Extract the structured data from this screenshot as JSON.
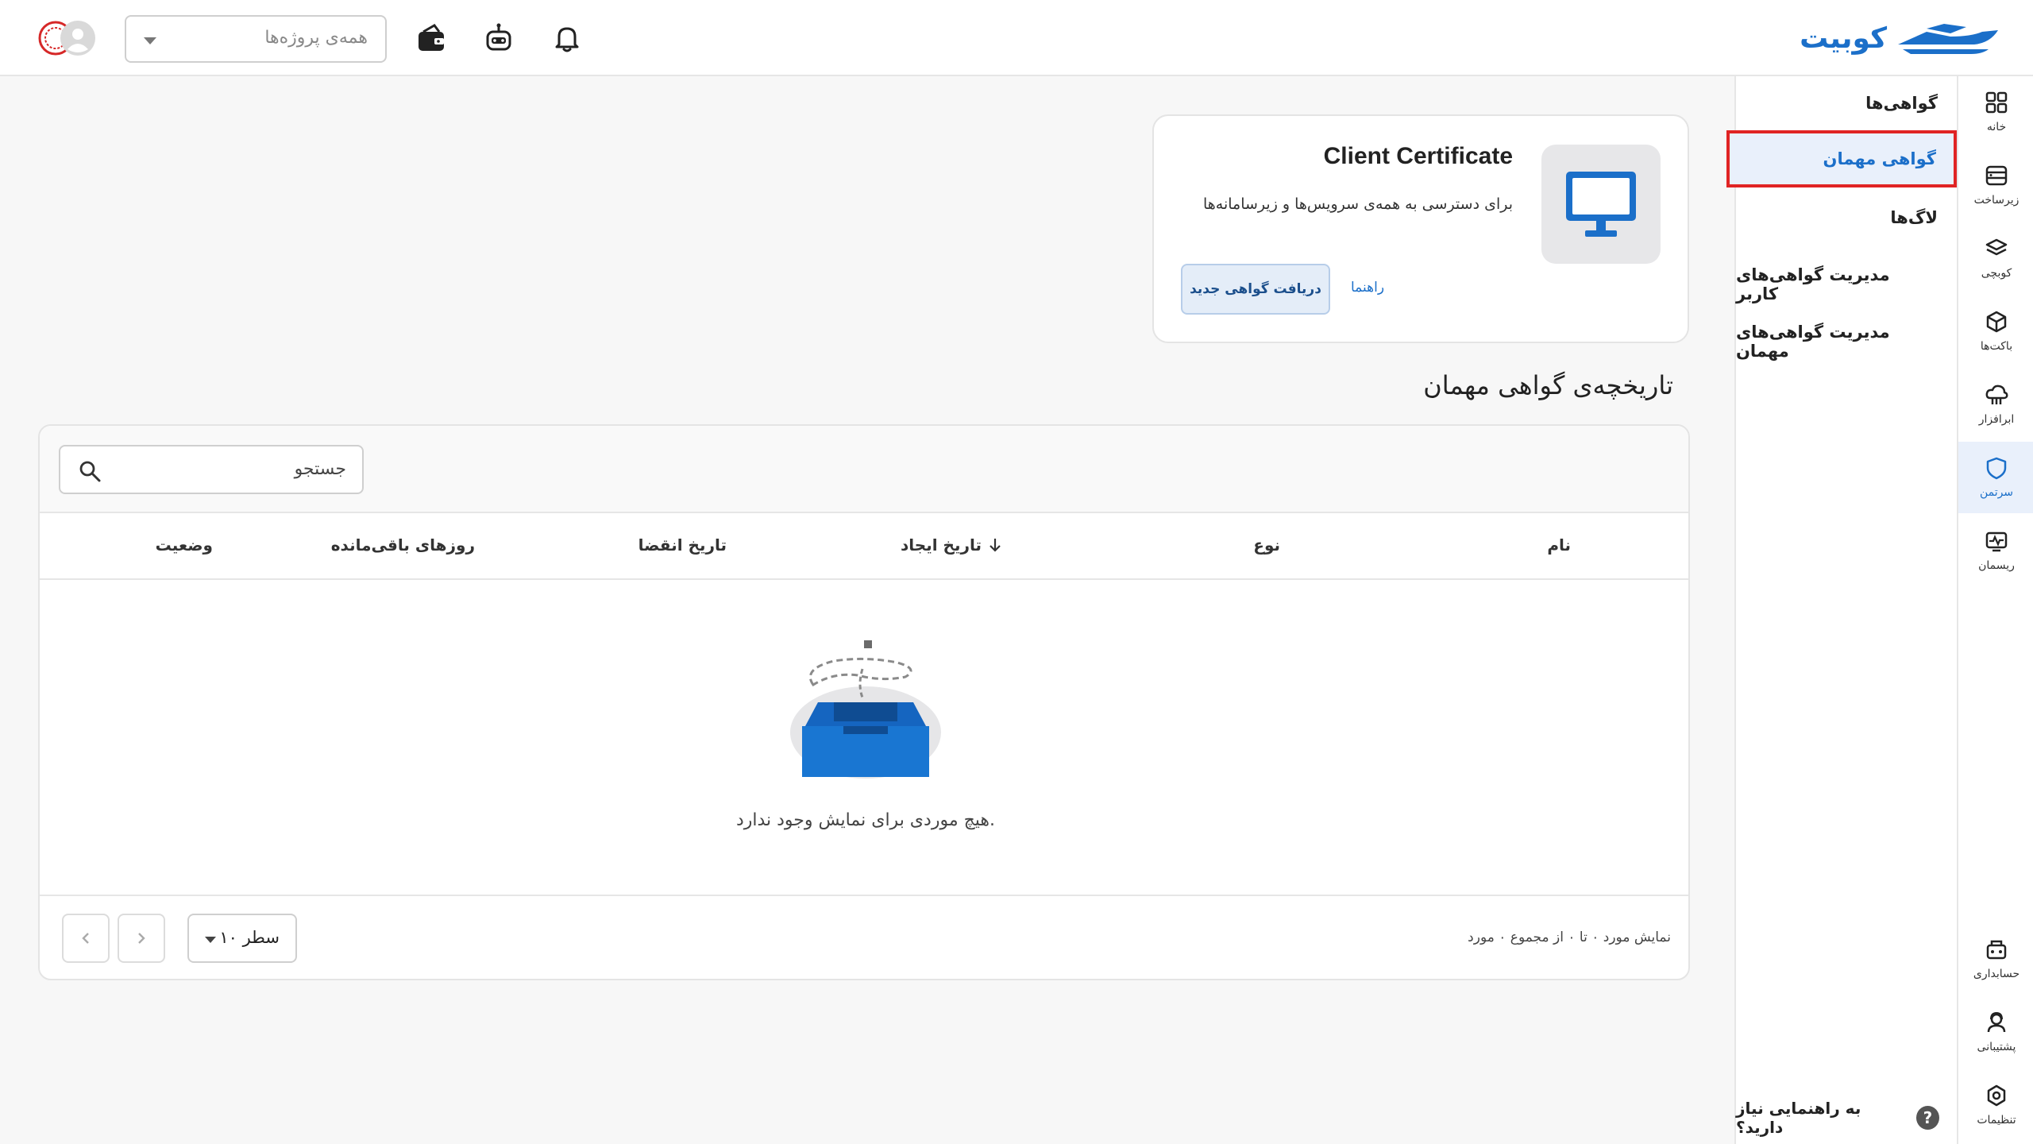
{
  "brand": {
    "name": "کوبیت",
    "color": "#1b6fc9"
  },
  "header": {
    "project_select": {
      "value": "همه‌ی پروژه‌ها"
    },
    "icons": [
      "bell-icon",
      "robot-icon",
      "wallet-icon",
      "user-avatar-icon"
    ]
  },
  "rail": {
    "items": [
      {
        "label": "خانه",
        "icon": "grid-icon"
      },
      {
        "label": "زیرساخت",
        "icon": "server-icon"
      },
      {
        "label": "کوبچی",
        "icon": "layers-icon"
      },
      {
        "label": "باکت‌ها",
        "icon": "cube-icon"
      },
      {
        "label": "ابرافزار",
        "icon": "cloud-app-icon"
      },
      {
        "label": "سرتمن",
        "icon": "shield-icon",
        "active": true
      },
      {
        "label": "ریسمان",
        "icon": "monitor-pulse-icon"
      }
    ],
    "bottom": [
      {
        "label": "حسابداری",
        "icon": "accounting-icon"
      },
      {
        "label": "پشتیبانی",
        "icon": "support-icon"
      },
      {
        "label": "تنظیمات",
        "icon": "settings-icon"
      }
    ]
  },
  "subnav": {
    "items": [
      {
        "label": "گواهی‌ها"
      },
      {
        "label": "گواهی مهمان",
        "active": true
      },
      {
        "label": "لاگ‌ها"
      },
      {
        "label": "مدیریت گواهی‌های کاربر"
      },
      {
        "label": "مدیریت گواهی‌های مهمان"
      }
    ],
    "help": "به راهنمایی نیاز دارید؟",
    "help_badge": "?"
  },
  "cert_card": {
    "title": "Client Certificate",
    "description": "برای دسترسی به همه‌ی سرویس‌ها و زیرسامانه‌ها",
    "primary_button": "دریافت گواهی جدید",
    "guide_link": "راهنما",
    "icon": "monitor-icon"
  },
  "history": {
    "title": "تاریخچه‌ی گواهی مهمان",
    "search_placeholder": "جستجو",
    "columns": [
      "نام",
      "نوع",
      "تاریخ ایجاد",
      "تاریخ انقضا",
      "روزهای باقی‌مانده",
      "وضعیت"
    ],
    "sorted_column": "تاریخ ایجاد",
    "rows": [],
    "empty_text": "هیچ موردی برای نمایش وجود ندارد.",
    "rows_per_page": "۱۰ سطر",
    "range_text": "نمایش مورد ۰ تا ۰ از مجموع ۰ مورد"
  },
  "colors": {
    "accent": "#1b6fc9",
    "highlight_border": "#e02424",
    "active_bg": "#e9f0fb"
  }
}
